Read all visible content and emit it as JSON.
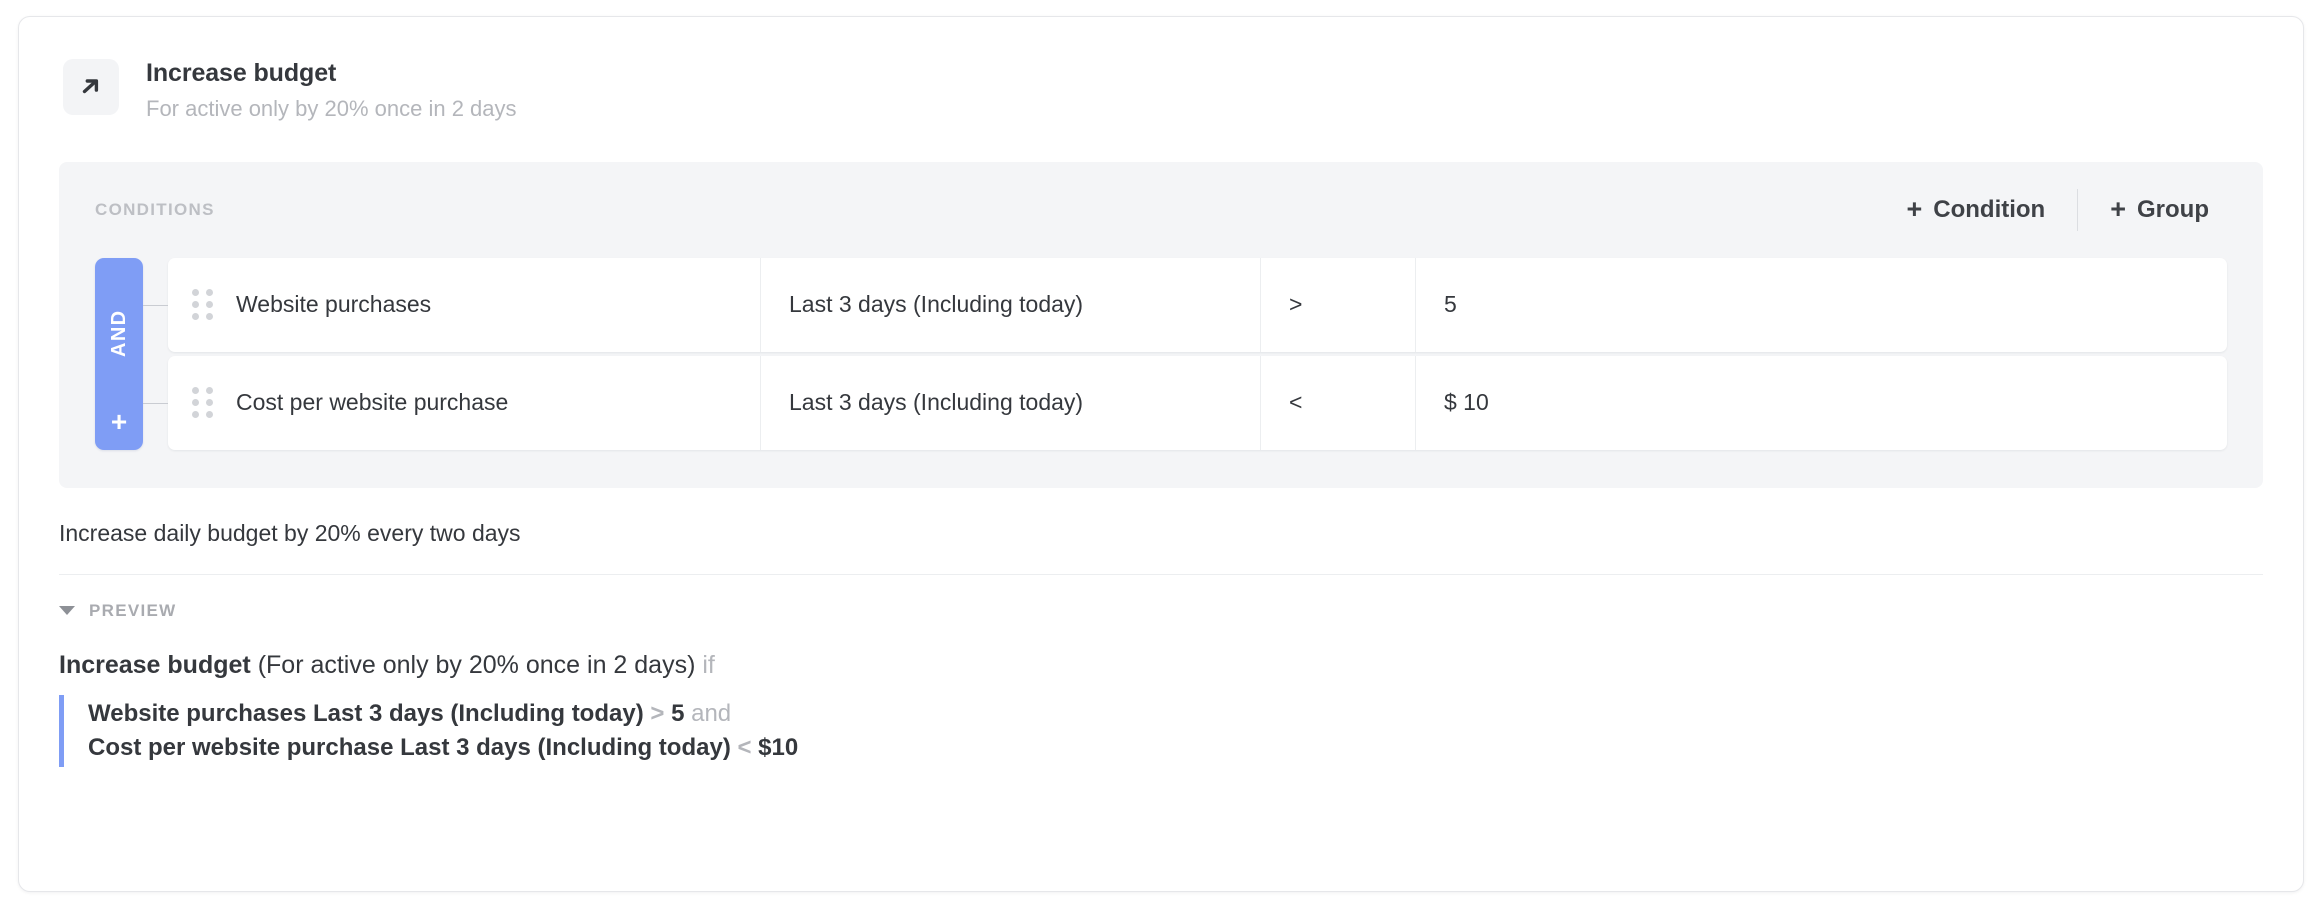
{
  "rule": {
    "icon": "arrow-up-right-icon",
    "title": "Increase budget",
    "subtitle": "For active only by 20% once in 2 days",
    "description": "Increase daily budget by 20% every two days"
  },
  "conditions_panel": {
    "label": "CONDITIONS",
    "add_condition_label": "Condition",
    "add_group_label": "Group",
    "plus_glyph": "+",
    "group": {
      "operator_label": "AND",
      "add_glyph": "+"
    },
    "rows": [
      {
        "metric": "Website purchases",
        "date_range": "Last 3 days (Including today)",
        "operator": ">",
        "value": "5"
      },
      {
        "metric": "Cost per website purchase",
        "date_range": "Last 3 days (Including today)",
        "operator": "<",
        "value": "$ 10"
      }
    ]
  },
  "preview": {
    "label": "PREVIEW",
    "expanded": true,
    "headline_action": "Increase budget",
    "headline_params": "(For active only by 20% once in 2 days)",
    "headline_if": "if",
    "lines": [
      {
        "subject": "Website purchases Last 3 days (Including today)",
        "operator": ">",
        "value": "5",
        "conjunction": "and"
      },
      {
        "subject": "Cost per website purchase Last 3 days (Including today)",
        "operator": "<",
        "value": "$10",
        "conjunction": ""
      }
    ]
  },
  "colors": {
    "accent_blue": "#7f9df5",
    "panel_bg": "#f4f5f7",
    "text_primary": "#35383d",
    "text_muted": "#b4b6bb"
  }
}
